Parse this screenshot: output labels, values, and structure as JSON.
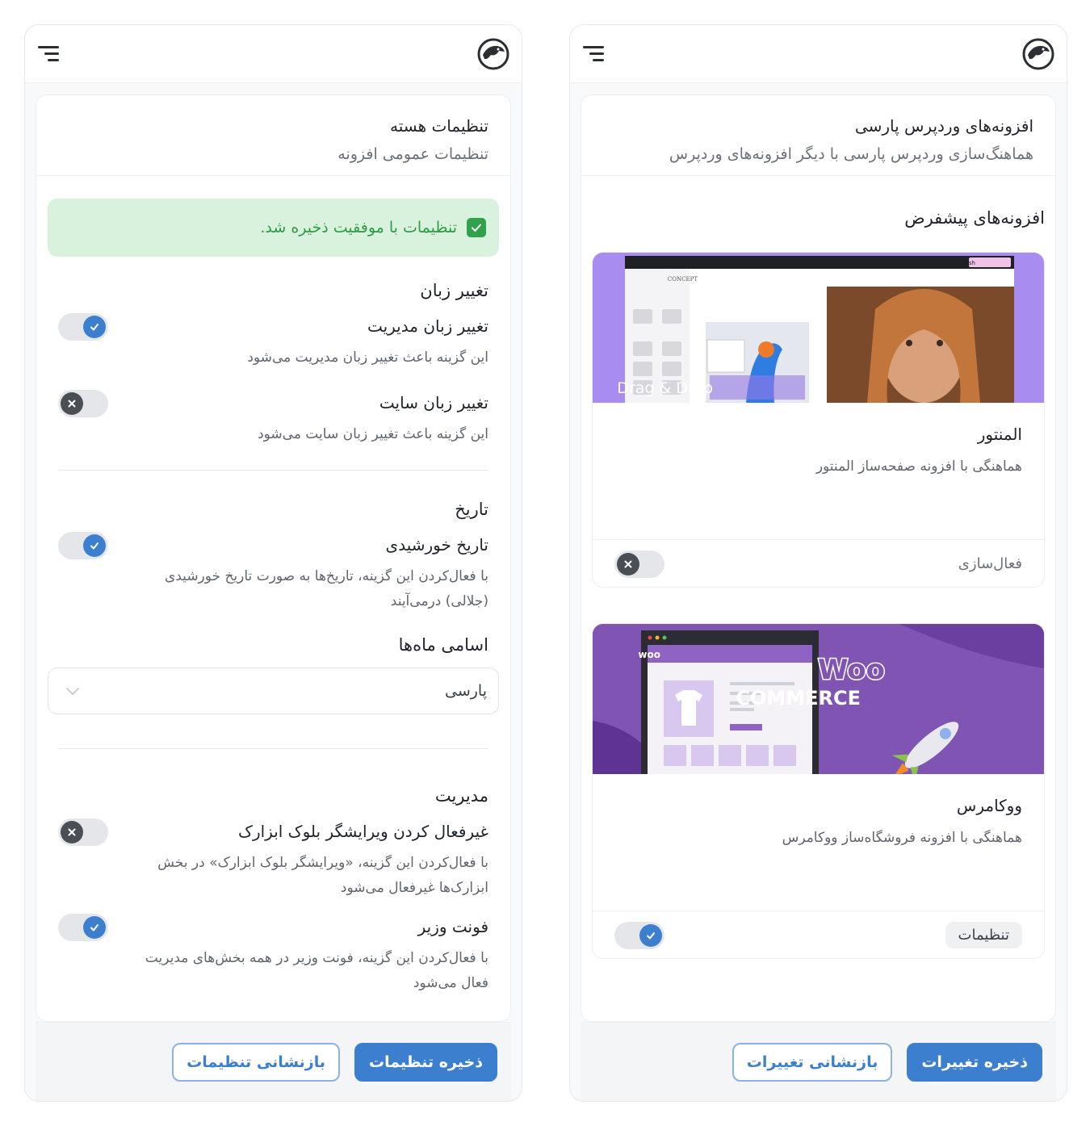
{
  "left": {
    "header": {
      "title": "تنظیمات هسته",
      "subtitle": "تنظیمات عمومی افزونه"
    },
    "alert": {
      "text": "تنظیمات با موفقیت ذخیره شد."
    },
    "language": {
      "title": "تغییر زبان",
      "admin": {
        "label": "تغییر زبان مدیریت",
        "desc": "این گزینه باعث تغییر زبان مدیریت می‌شود",
        "on": true
      },
      "site": {
        "label": "تغییر زبان سایت",
        "desc": "این گزینه باعث تغییر زبان سایت می‌شود",
        "on": false
      }
    },
    "date": {
      "title": "تاریخ",
      "solar": {
        "label": "تاریخ خورشیدی",
        "desc": "با فعال‌کردن این گزینه، تاریخ‌ها به صورت تاریخ خورشیدی (جلالی) درمی‌آیند",
        "on": true
      },
      "months_title": "اسامی ماه‌ها",
      "months_value": "پارسی"
    },
    "admin": {
      "title": "مدیریت",
      "block_editor": {
        "label": "غیرفعال کردن ویرایشگر بلوک ابزارک",
        "desc": "با فعال‌کردن این گزینه، «ویرایشگر بلوک ابزارک» در بخش ابزارک‌ها غیرفعال می‌شود",
        "on": false
      },
      "vazir": {
        "label": "فونت وزیر",
        "desc": "با فعال‌کردن این گزینه، فونت وزیر در همه بخش‌های مدیریت فعال می‌شود",
        "on": true
      }
    },
    "footer": {
      "save": "ذخیره تنظیمات",
      "reset": "بازنشانی تنظیمات"
    }
  },
  "right": {
    "header": {
      "title": "افزونه‌های وردپرس پارسی",
      "subtitle": "هماهنگ‌سازی وردپرس پارسی با دیگر افزونه‌های وردپرس"
    },
    "plugins_title": "افزونه‌های پیشفرض",
    "elementor": {
      "name": "المنتور",
      "desc": "هماهنگی با افزونه صفحه‌ساز المنتور",
      "foot_label": "فعال‌سازی",
      "on": false,
      "img_caption": "Drag & Drop",
      "img_concept": "CONCEPT",
      "img_publish": "Publish"
    },
    "woo": {
      "name": "ووکامرس",
      "desc": "هماهنگی با افزونه فروشگاه‌ساز ووکامرس",
      "foot_label": "تنظیمات",
      "on": true,
      "logo_woo": "Woo",
      "logo_commerce": "COMMERCE",
      "small_woo": "woo"
    },
    "footer": {
      "save": "ذخیره تغییرات",
      "reset": "بازنشانی تغییرات"
    }
  },
  "colors": {
    "primary": "#3d7fcf",
    "success_bg": "#d9f2dd",
    "success_text": "#2f9a46",
    "woo_purple": "#7f54b3"
  }
}
